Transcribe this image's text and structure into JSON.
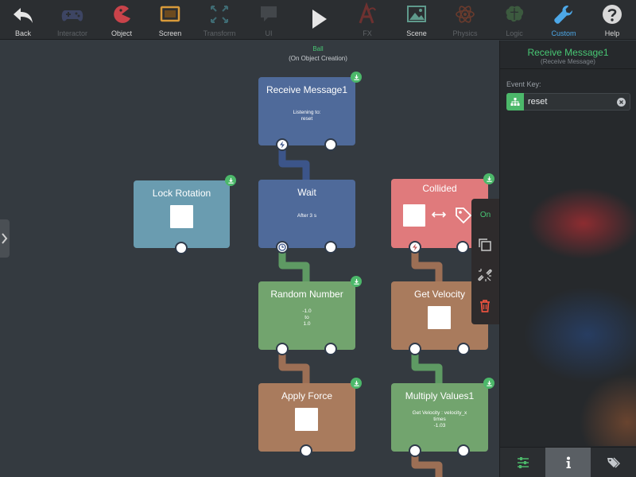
{
  "toolbar": {
    "items": [
      {
        "label": "Back",
        "icon": "back-arrow-icon",
        "state": "normal"
      },
      {
        "label": "Interactor",
        "icon": "gamepad-icon",
        "state": "dim"
      },
      {
        "label": "Object",
        "icon": "pacman-icon",
        "state": "normal"
      },
      {
        "label": "Screen",
        "icon": "screen-icon",
        "state": "normal"
      },
      {
        "label": "Transform",
        "icon": "transform-icon",
        "state": "dim"
      },
      {
        "label": "UI",
        "icon": "speech-bubble-icon",
        "state": "dim"
      },
      {
        "label": "",
        "icon": "play-icon",
        "state": "normal"
      },
      {
        "label": "FX",
        "icon": "fx-icon",
        "state": "dim"
      },
      {
        "label": "Scene",
        "icon": "image-icon",
        "state": "normal"
      },
      {
        "label": "Physics",
        "icon": "atom-icon",
        "state": "dim"
      },
      {
        "label": "Logic",
        "icon": "brain-icon",
        "state": "dim"
      },
      {
        "label": "Custom",
        "icon": "wrench-icon",
        "state": "active"
      },
      {
        "label": "Help",
        "icon": "help-icon",
        "state": "normal"
      }
    ]
  },
  "canvas": {
    "actor_name": "Ball",
    "actor_event": "(On Object Creation)"
  },
  "blocks": {
    "receive_message": {
      "title": "Receive Message1",
      "body": "Listening to:\nreset"
    },
    "wait": {
      "title": "Wait",
      "body": "After 3 s"
    },
    "lock_rotation": {
      "title": "Lock Rotation"
    },
    "collided": {
      "title": "Collided"
    },
    "random_number": {
      "title": "Random Number",
      "body": "-1.0\nto\n1.0"
    },
    "get_velocity": {
      "title": "Get Velocity"
    },
    "apply_force": {
      "title": "Apply Force"
    },
    "multiply_values": {
      "title": "Multiply Values1",
      "body": "Get Velocity : velocity_x\ntimes\n-1.03"
    }
  },
  "context_menu": {
    "on_label": "On",
    "items": [
      "duplicate-icon",
      "unlink-icon",
      "trash-icon"
    ]
  },
  "panel": {
    "title": "Receive Message1",
    "subtitle": "(Receive Message)",
    "event_key_label": "Event Key:",
    "event_key_value": "reset",
    "tabs": [
      "sliders-icon",
      "info-icon",
      "tags-icon"
    ]
  },
  "colors": {
    "accent_green": "#48c774",
    "active_blue": "#4da8e8",
    "block_blue": "#4f6a9a",
    "block_teal": "#6a9cb0",
    "block_green": "#72a46e",
    "block_brown": "#a97b5d",
    "block_red": "#e07a7c",
    "delete_red": "#e8523f"
  }
}
